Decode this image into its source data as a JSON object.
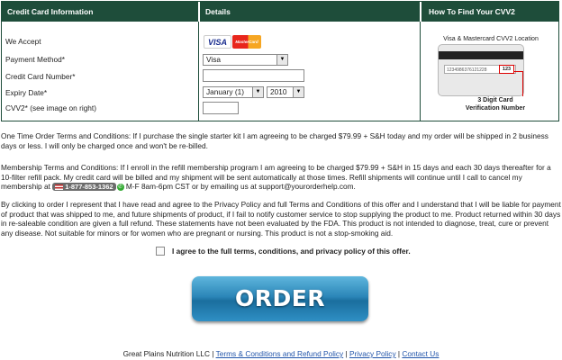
{
  "headers": {
    "col1": "Credit Card Information",
    "col2": "Details",
    "col3": "How To Find Your CVV2"
  },
  "form": {
    "we_accept_label": "We Accept",
    "cards": [
      "VISA",
      "MasterCard"
    ],
    "payment_method_label": "Payment Method*",
    "payment_method_value": "Visa",
    "card_number_label": "Credit Card Number*",
    "card_number_value": "",
    "expiry_label": "Expiry Date*",
    "expiry_month_value": "January (1)",
    "expiry_year_value": "2010",
    "cvv_label": "CVV2* (see image on right)",
    "cvv_value": ""
  },
  "cvv_help": {
    "title": "Visa & Mastercard CVV2 Location",
    "card_number_sample": "1234986376121228",
    "code_sample": "123",
    "caption_line1": "3 Digit Card",
    "caption_line2": "Verification Number"
  },
  "terms": {
    "one_time": "One Time Order Terms and Conditions: If I purchase the single starter kit I am agreeing to be charged $79.99 + S&H today and my order will be shipped in 2 business days or less. I will only be charged once and won't be re-billed.",
    "membership_part1": "Membership Terms and Conditions: If I enroll in the refill membership program I am agreeing to be charged $79.99 + S&H in 15 days and each 30 days thereafter for a 10-filter refill pack. My credit card will be billed and my shipment will be sent automatically at those times. Refill shipments will continue until I call to cancel my membership at",
    "phone": "1-877-853-1362",
    "membership_part2": "M-F 8am-6pm CST or by emailing us at support@yourorderhelp.com.",
    "agreement": "By clicking to order I represent that I have read and agree to the Privacy Policy and full Terms and Conditions of this offer and I understand that I will be liable for payment of product that was shipped to me, and future shipments of product, if I fail to notify customer service to stop supplying the product to me. Product returned within 30 days in re-saleable condition are given a full refund. These statements have not been evaluated by the FDA. This product is not intended to diagnose, treat, cure or prevent any disease. Not suitable for minors or for women who are pregnant or nursing. This product is not a stop-smoking aid."
  },
  "agree_checkbox_label": "I agree to the full terms, conditions, and privacy policy of this offer.",
  "order_button_label": "ORDER",
  "footer": {
    "company": "Great Plains Nutrition LLC",
    "sep": "|",
    "link_terms": "Terms & Conditions and Refund Policy",
    "link_privacy": "Privacy Policy",
    "link_contact": "Contact Us"
  },
  "colors": {
    "header_bg": "#1e4d3a",
    "button_blue": "#2b86b8",
    "link": "#2255aa"
  }
}
